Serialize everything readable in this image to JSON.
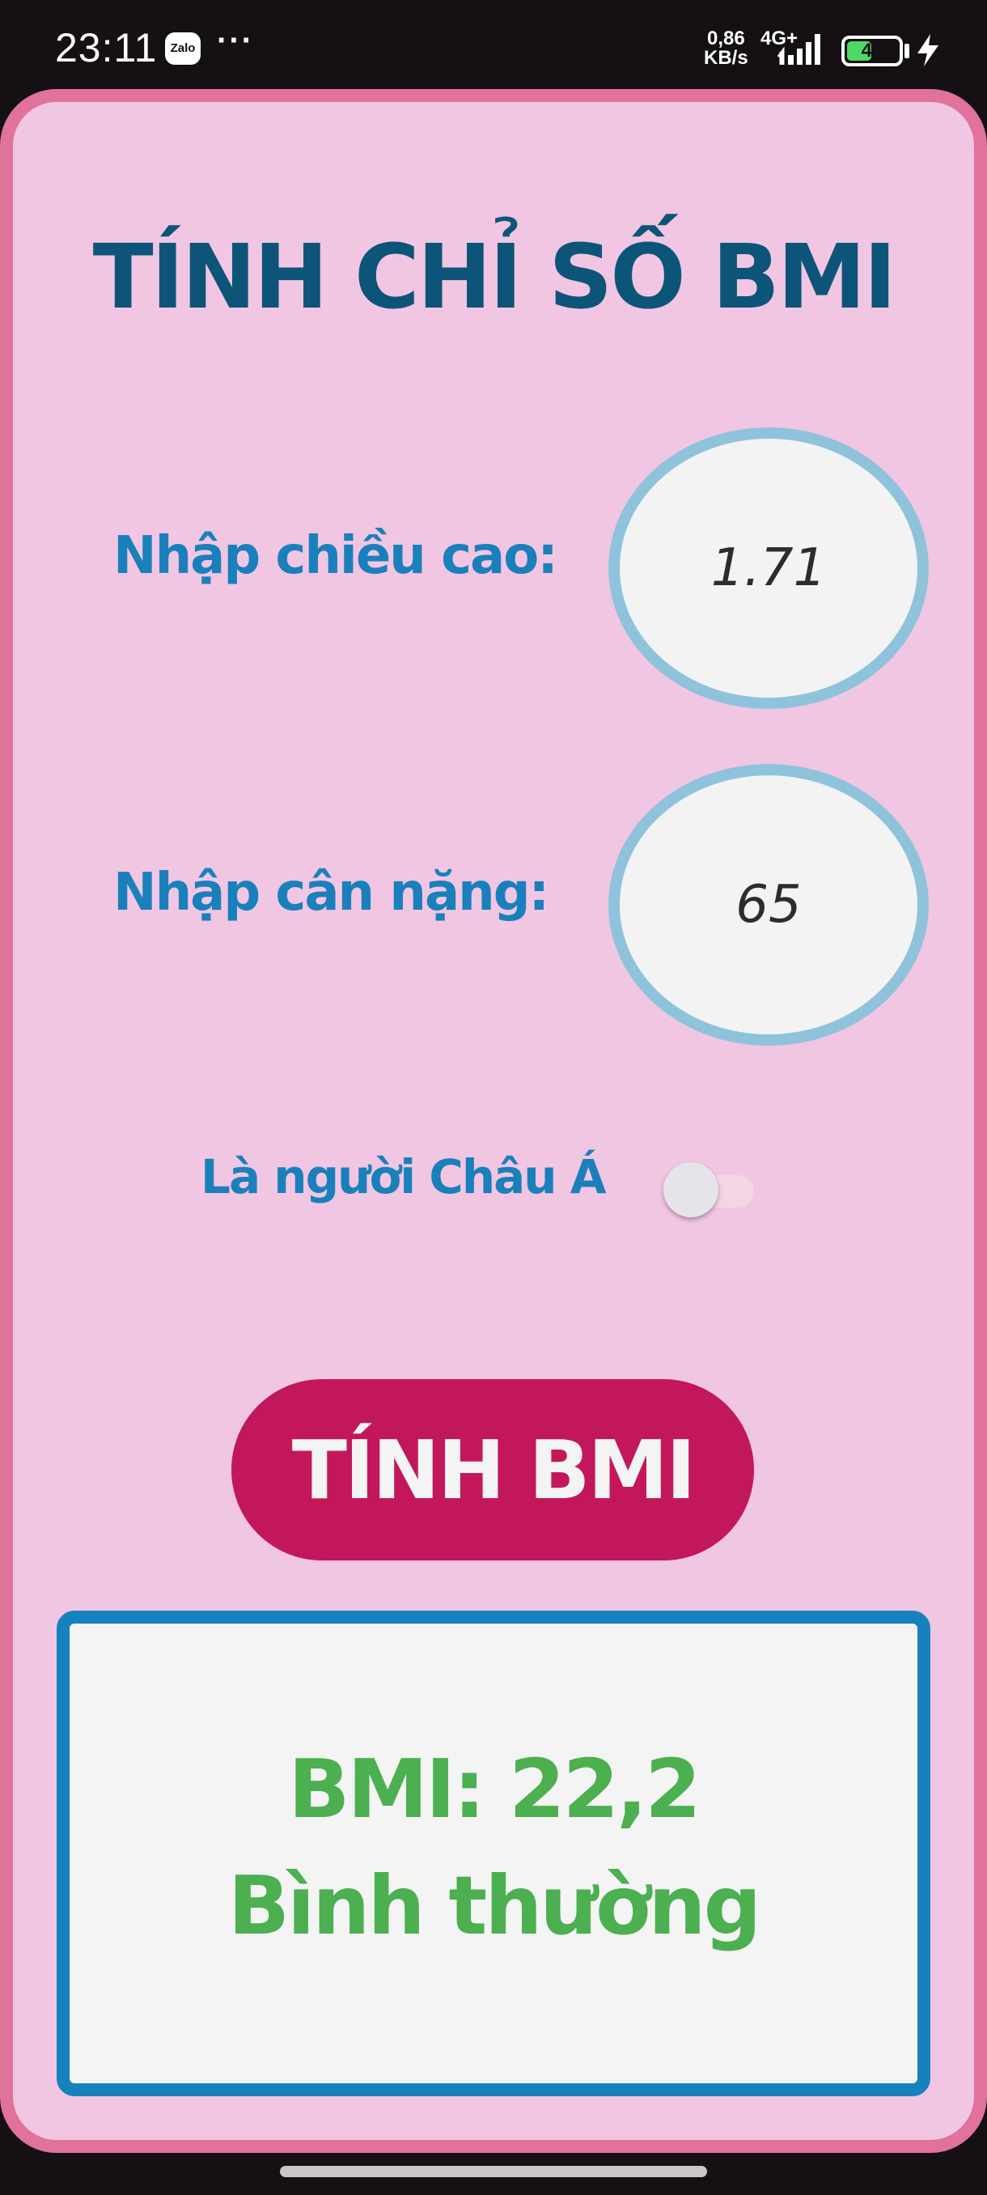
{
  "status_bar": {
    "time": "23:11",
    "app_icon_label": "Zalo",
    "more": "···",
    "net_speed_value": "0,86",
    "net_speed_unit": "KB/s",
    "network_type": "4G+",
    "battery_level": "49",
    "battery_fraction": 0.49,
    "charging": true
  },
  "title": "TÍNH CHỈ SỐ BMI",
  "height_field": {
    "label": "Nhập chiều cao:",
    "value": "1.71"
  },
  "weight_field": {
    "label": "Nhập cân nặng:",
    "value": "65"
  },
  "asian_toggle": {
    "label": "Là người Châu Á",
    "on": false
  },
  "calculate_button": "TÍNH BMI",
  "result": {
    "bmi_text": "BMI: 22,2",
    "category": "Bình thường",
    "color": "#4caf50"
  },
  "colors": {
    "frame_border": "#e0729c",
    "background": "#f1c6e3",
    "title": "#0c5578",
    "label": "#1a80bb",
    "input_border": "#8fc3dc",
    "button": "#c2185b",
    "result_border": "#1682bd"
  }
}
